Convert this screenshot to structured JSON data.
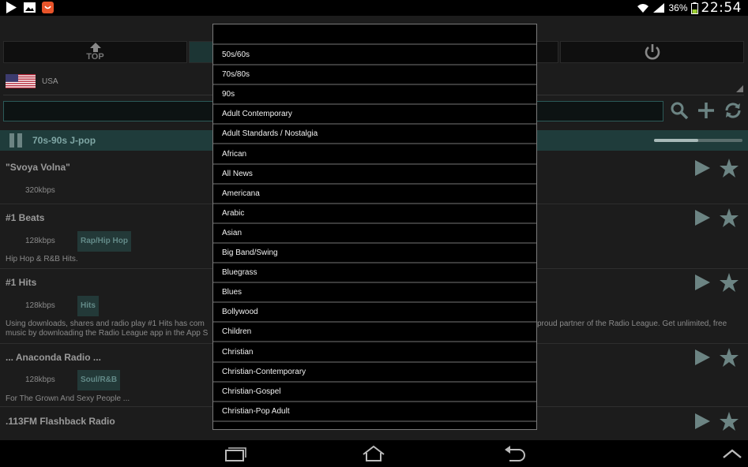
{
  "status_bar": {
    "icons_left": [
      "play-store-icon",
      "gallery-icon",
      "app-notification-icon"
    ],
    "battery_percent": "36%",
    "time": "22:54"
  },
  "app": {
    "tabs": [
      {
        "label": "TOP",
        "icon": "up-arrow-icon"
      },
      {
        "label": "",
        "icon": ""
      },
      {
        "label": "",
        "icon": ""
      },
      {
        "label": "",
        "icon": "power-icon"
      }
    ],
    "country": {
      "label": "USA",
      "flag": "us-flag-icon"
    },
    "search": {
      "placeholder": ""
    },
    "now_playing": {
      "title": "70s-90s J-pop",
      "progress": 0.5
    },
    "stations": [
      {
        "name": "\"Svoya Volna\"",
        "bitrate": "320kbps",
        "genre": "",
        "description": ""
      },
      {
        "name": "#1 Beats",
        "bitrate": "128kbps",
        "genre": "Rap/Hip Hop",
        "description": "Hip Hop & R&B Hits."
      },
      {
        "name": "#1 Hits",
        "bitrate": "128kbps",
        "genre": "Hits",
        "description_left": "Using downloads, shares and radio play #1 Hits has com",
        "description_right": "proud partner of the Radio League. Get unlimited, free",
        "description_line2": "music by downloading the Radio League app in the App S"
      },
      {
        "name": "... Anaconda Radio ...",
        "bitrate": "128kbps",
        "genre": "Soul/R&B",
        "description": "For The Grown And Sexy People ..."
      },
      {
        "name": ".113FM Flashback Radio",
        "bitrate": "",
        "genre": "",
        "description": ""
      }
    ]
  },
  "dropdown": {
    "items": [
      "50s/60s",
      "70s/80s",
      "90s",
      "Adult Contemporary",
      "Adult Standards / Nostalgia",
      "African",
      "All News",
      "Americana",
      "Arabic",
      "Asian",
      "Big Band/Swing",
      "Bluegrass",
      "Blues",
      "Bollywood",
      "Children",
      "Christian",
      "Christian-Contemporary",
      "Christian-Gospel",
      "Christian-Pop Adult"
    ]
  },
  "nav_bar": {
    "buttons": [
      "recent-apps-icon",
      "home-icon",
      "back-icon",
      "chevron-up-icon"
    ]
  },
  "colors": {
    "accent": "#2b5a58",
    "now_playing_bg": "#1f3c3b",
    "popup_border": "#7a7a7a"
  }
}
